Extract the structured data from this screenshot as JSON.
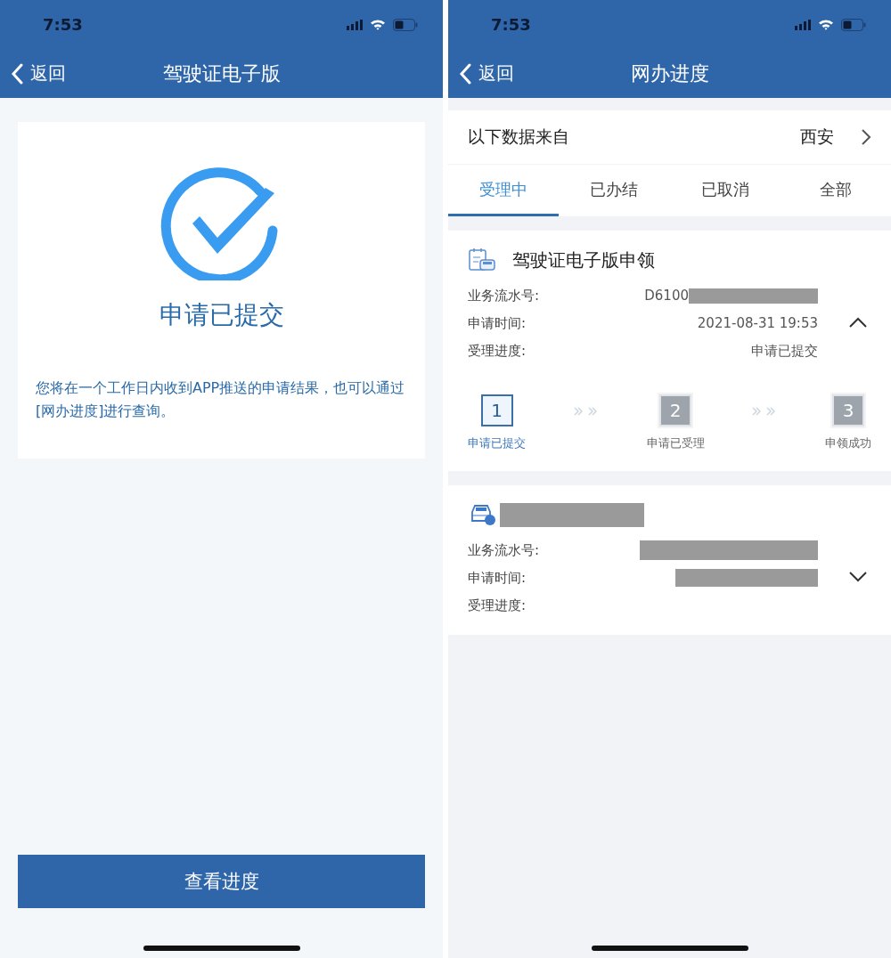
{
  "left_screen": {
    "status_bar": {
      "time": "7:53"
    },
    "nav": {
      "back": "返回",
      "title": "驾驶证电子版"
    },
    "result": {
      "title": "申请已提交",
      "message": "您将在一个工作日内收到APP推送的申请结果，也可以通过[网办进度]进行查询。"
    },
    "button": "查看进度"
  },
  "right_screen": {
    "status_bar": {
      "time": "7:53"
    },
    "nav": {
      "back": "返回",
      "title": "网办进度"
    },
    "source": {
      "label": "以下数据来自",
      "value": "西安"
    },
    "tabs": [
      {
        "label": "受理中",
        "selected": true
      },
      {
        "label": "已办结",
        "selected": false
      },
      {
        "label": "已取消",
        "selected": false
      },
      {
        "label": "全部",
        "selected": false
      }
    ],
    "cards": [
      {
        "kind": "document",
        "title": "驾驶证电子版申领",
        "expanded": true,
        "rows": [
          {
            "label": "业务流水号:",
            "value": "D6100",
            "redacted": true
          },
          {
            "label": "申请时间:",
            "value": "2021-08-31 19:53"
          },
          {
            "label": "受理进度:",
            "value": "申请已提交"
          }
        ],
        "steps": [
          {
            "number": "1",
            "label": "申请已提交",
            "selected": true
          },
          {
            "number": "2",
            "label": "申请已受理",
            "selected": false
          },
          {
            "number": "3",
            "label": "申领成功",
            "selected": false
          }
        ]
      },
      {
        "kind": "car",
        "title_redacted": true,
        "expanded": false,
        "rows": [
          {
            "label": "业务流水号:",
            "redacted": true
          },
          {
            "label": "申请时间:",
            "redacted": true
          },
          {
            "label": "受理进度:"
          }
        ]
      }
    ]
  }
}
